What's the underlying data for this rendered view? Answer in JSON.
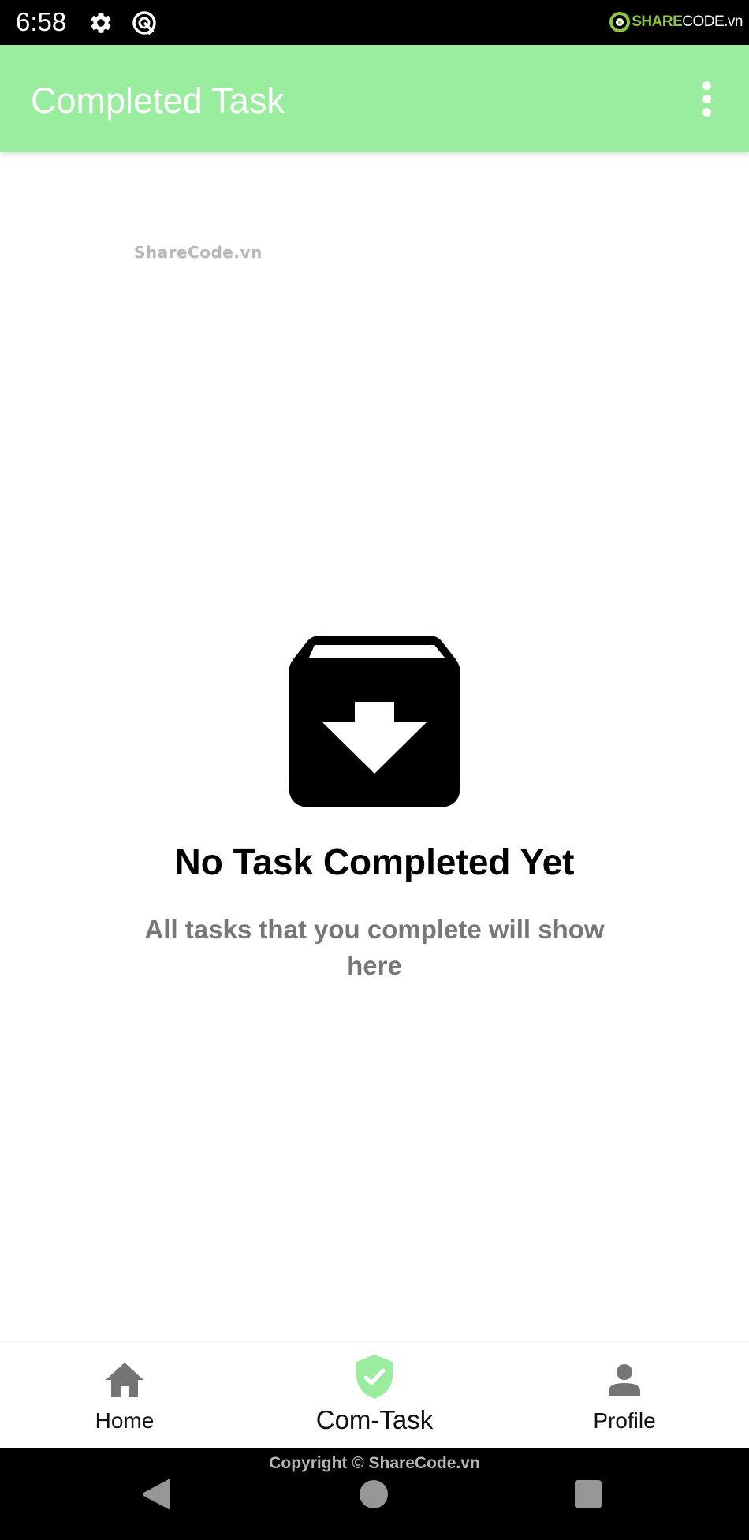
{
  "status_bar": {
    "time": "6:58",
    "left_icons": [
      "gear-icon",
      "q-launcher-icon"
    ],
    "watermark_logo": {
      "share": "SHARE",
      "code": "CODE.vn"
    }
  },
  "app_bar": {
    "title": "Completed Task",
    "overflow_icon": "more-vert-icon",
    "background_color": "#9AEC9E"
  },
  "content": {
    "watermark": "ShareCode.vn",
    "empty_state": {
      "icon": "archive-download-icon",
      "title": "No Task Completed Yet",
      "subtitle": "All tasks that you complete will show here"
    }
  },
  "bottom_nav": {
    "items": [
      {
        "label": "Home",
        "icon": "home-icon",
        "active": false
      },
      {
        "label": "Com-Task",
        "icon": "shield-check-icon",
        "active": true
      },
      {
        "label": "Profile",
        "icon": "person-icon",
        "active": false
      }
    ],
    "active_color": "#9AEC9E",
    "inactive_icon_color": "#757575"
  },
  "system_nav": {
    "copyright": "Copyright © ShareCode.vn",
    "buttons": [
      "back",
      "home",
      "recents"
    ]
  }
}
